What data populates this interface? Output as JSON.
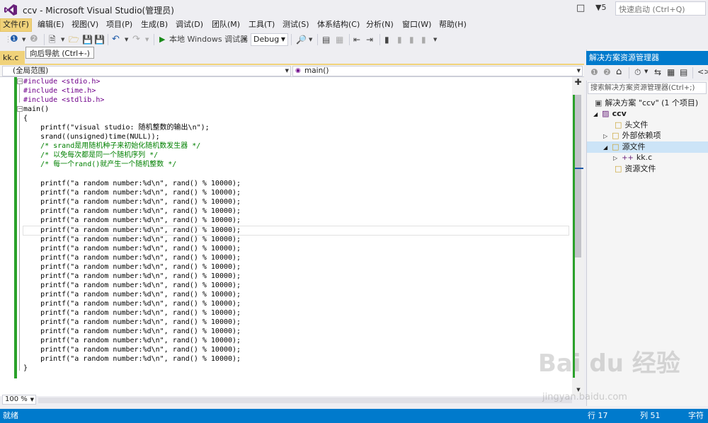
{
  "window": {
    "title": "ccv - Microsoft Visual Studio(管理员)",
    "notification_count": "5",
    "quick_launch_placeholder": "快速启动 (Ctrl+Q)"
  },
  "menu": [
    "文件(F)",
    "编辑(E)",
    "视图(V)",
    "项目(P)",
    "生成(B)",
    "调试(D)",
    "团队(M)",
    "工具(T)",
    "测试(S)",
    "体系结构(C)",
    "分析(N)",
    "窗口(W)",
    "帮助(H)"
  ],
  "toolbar": {
    "run_label": "本地 Windows 调试器",
    "config": "Debug",
    "tooltip": "向后导航 (Ctrl+-)"
  },
  "editor": {
    "tab": "kk.c",
    "scope": "(全局范围)",
    "function": "main()",
    "zoom": "100 %",
    "lines": {
      "l1": "#include <stdio.h>",
      "l2": "#include <time.h>",
      "l3": "#include <stdlib.h>",
      "l4": "main()",
      "l5": "{",
      "l6": "    printf(\"visual studio: 随机整数的输出\\n\");",
      "l7": "    srand((unsigned)time(NULL));",
      "l8": "    /* srand是用随机种子来初始化随机数发生器 */",
      "l9": "    /* 以免每次都是同一个随机序列 */",
      "l10": "    /* 每一个rand()就产生一个随机整数 */",
      "printf_line": "    printf(\"a random number:%d\\n\", rand() % 10000);",
      "close": "}"
    }
  },
  "solution_explorer": {
    "title": "解决方案资源管理器",
    "search_placeholder": "搜索解决方案资源管理器(Ctrl+;)",
    "nodes": {
      "solution": "解决方案 \"ccv\" (1 个项目)",
      "project": "ccv",
      "headers": "头文件",
      "external": "外部依赖项",
      "sources": "源文件",
      "file": "kk.c",
      "resources": "资源文件"
    }
  },
  "status": {
    "ready": "就绪",
    "line": "行 17",
    "col": "列 51",
    "char": "字符"
  },
  "watermark": {
    "brand": "Bai du 经验",
    "url": "jingyan.baidu.com"
  },
  "colors": {
    "accent": "#007acc",
    "tab_active": "#f0d27a",
    "change_bar": "#2aa12a"
  }
}
